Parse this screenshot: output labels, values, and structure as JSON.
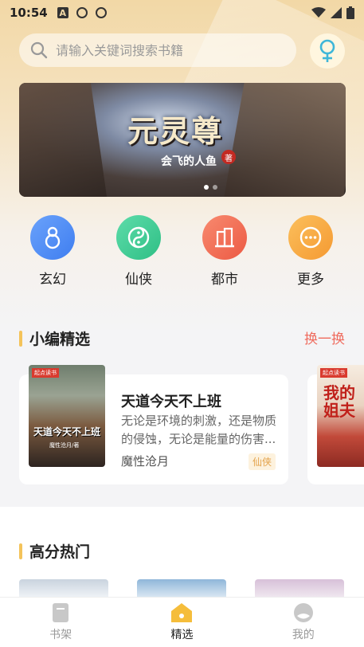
{
  "status": {
    "time": "10:54",
    "icons": [
      "a-icon",
      "q-icon",
      "q-icon",
      "wifi-icon",
      "signal-icon",
      "battery-icon"
    ]
  },
  "search": {
    "placeholder": "请输入关键词搜索书籍",
    "icon": "search-icon"
  },
  "gender_button": {
    "icon": "female-icon"
  },
  "banner": {
    "title": "元灵尊",
    "author": "会飞的人鱼",
    "seal": "著",
    "dots": 2,
    "active_dot": 0
  },
  "categories": [
    {
      "label": "玄幻",
      "icon": "gourd-icon",
      "color": "#4f8ef7"
    },
    {
      "label": "仙侠",
      "icon": "yin-yang-icon",
      "color": "#3fcf99"
    },
    {
      "label": "都市",
      "icon": "building-icon",
      "color": "#f06d55"
    },
    {
      "label": "更多",
      "icon": "more-icon",
      "color": "#f8a73f"
    }
  ],
  "editor_picks": {
    "title": "小编精选",
    "swap_label": "换一换",
    "books": [
      {
        "title": "天道今天不上班",
        "desc": "无论是环境的刺激，还是物质的侵蚀，无论是能量的伤害...",
        "author": "魔性沧月",
        "tag": "仙侠",
        "cover_badge": "起点读书",
        "cover_title": "天道今天不上班",
        "cover_author": "魔性沧月/著"
      },
      {
        "cover_badge": "起点读书",
        "cover_title": "我的\n姐夫"
      }
    ]
  },
  "high_score": {
    "title": "高分热门"
  },
  "tabbar": [
    {
      "label": "书架",
      "icon": "bookshelf-icon",
      "active": false
    },
    {
      "label": "精选",
      "icon": "featured-home-icon",
      "active": true
    },
    {
      "label": "我的",
      "icon": "profile-icon",
      "active": false
    }
  ],
  "colors": {
    "accent": "#f4c35a",
    "swap": "#ef6b5e",
    "tag_text": "#e3a24a"
  }
}
